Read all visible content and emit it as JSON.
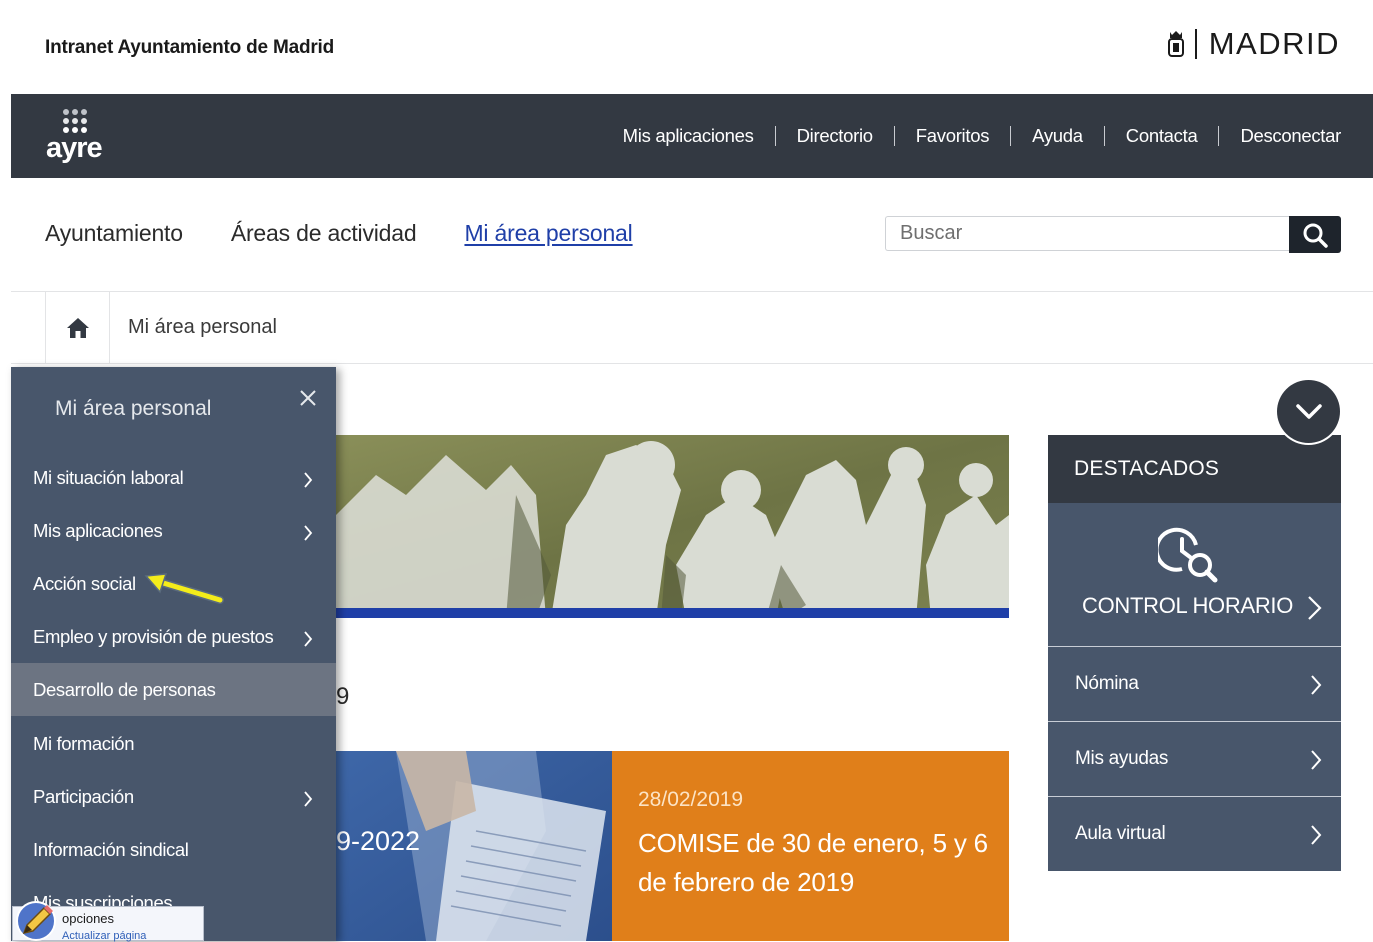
{
  "header": {
    "site_title": "Intranet Ayuntamiento de Madrid",
    "brand": "MADRID"
  },
  "topnav": {
    "logo": "ayre",
    "links": [
      "Mis aplicaciones",
      "Directorio",
      "Favoritos",
      "Ayuda",
      "Contacta",
      "Desconectar"
    ]
  },
  "mainnav": {
    "items": [
      "Ayuntamiento",
      "Áreas de actividad",
      "Mi área personal"
    ],
    "active": "Mi área personal"
  },
  "search": {
    "placeholder": "Buscar"
  },
  "breadcrumb": {
    "current": "Mi área personal"
  },
  "content": {
    "partial_heading": "9",
    "card_blue_partial": "9-2022",
    "card_orange": {
      "date": "28/02/2019",
      "title": "COMISE de 30 de enero, 5 y 6 de febrero de 2019"
    }
  },
  "destacados": {
    "title": "DESTACADOS",
    "featured": "CONTROL HORARIO",
    "items": [
      "Nómina",
      "Mis ayudas",
      "Aula virtual"
    ]
  },
  "sidemenu": {
    "title": "Mi área personal",
    "items": [
      {
        "label": "Mi situación laboral",
        "has_children": true
      },
      {
        "label": "Mis aplicaciones",
        "has_children": true
      },
      {
        "label": "Acción social",
        "has_children": false
      },
      {
        "label": "Empleo y provisión de puestos",
        "has_children": true
      },
      {
        "label": "Desarrollo de personas",
        "has_children": false,
        "highlighted": true
      },
      {
        "label": "Mi formación",
        "has_children": false
      },
      {
        "label": "Participación",
        "has_children": true
      },
      {
        "label": "Información sindical",
        "has_children": false
      },
      {
        "label": "Mis suscripciones",
        "has_children": false
      }
    ]
  },
  "overlay": {
    "label": "opciones",
    "sublabel": "Actualizar página"
  },
  "colors": {
    "nav_dark": "#333942",
    "panel": "#48566b",
    "link_active": "#1f3fa8",
    "card_orange": "#e07f1a",
    "arrow_yellow": "#f4ec1a"
  }
}
